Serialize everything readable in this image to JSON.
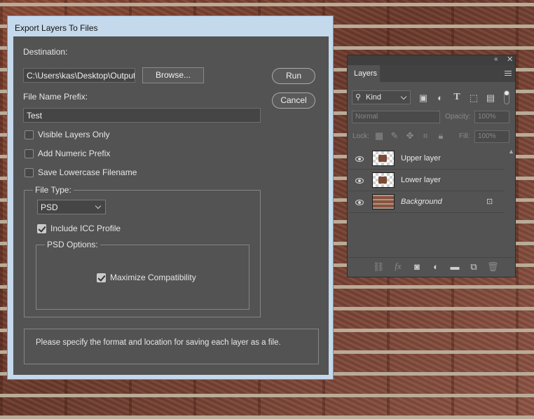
{
  "dialog": {
    "title": "Export Layers To Files",
    "destination_label": "Destination:",
    "destination_value": "C:\\Users\\kas\\Desktop\\Output",
    "browse_label": "Browse...",
    "run_label": "Run",
    "cancel_label": "Cancel",
    "prefix_label": "File Name Prefix:",
    "prefix_value": "Test",
    "options": [
      {
        "label": "Visible Layers Only",
        "checked": false
      },
      {
        "label": "Add Numeric Prefix",
        "checked": false
      },
      {
        "label": "Save Lowercase Filename",
        "checked": false
      }
    ],
    "file_type": {
      "legend": "File Type:",
      "selected": "PSD",
      "include_icc_label": "Include ICC Profile",
      "include_icc_checked": true,
      "psd_options_legend": "PSD Options:",
      "max_compat_label": "Maximize Compatibility",
      "max_compat_checked": true
    },
    "help_text": "Please specify the format and location for saving each layer as a file."
  },
  "layers_panel": {
    "tab_label": "Layers",
    "filter_kind": "Kind",
    "blend_mode": "Normal",
    "opacity_label": "Opacity:",
    "opacity_value": "100%",
    "lock_label": "Lock:",
    "fill_label": "Fill:",
    "fill_value": "100%",
    "layers": [
      {
        "name": "Upper layer",
        "visible": true,
        "locked": false
      },
      {
        "name": "Lower layer",
        "visible": true,
        "locked": false
      },
      {
        "name": "Background",
        "visible": true,
        "locked": true
      }
    ]
  }
}
